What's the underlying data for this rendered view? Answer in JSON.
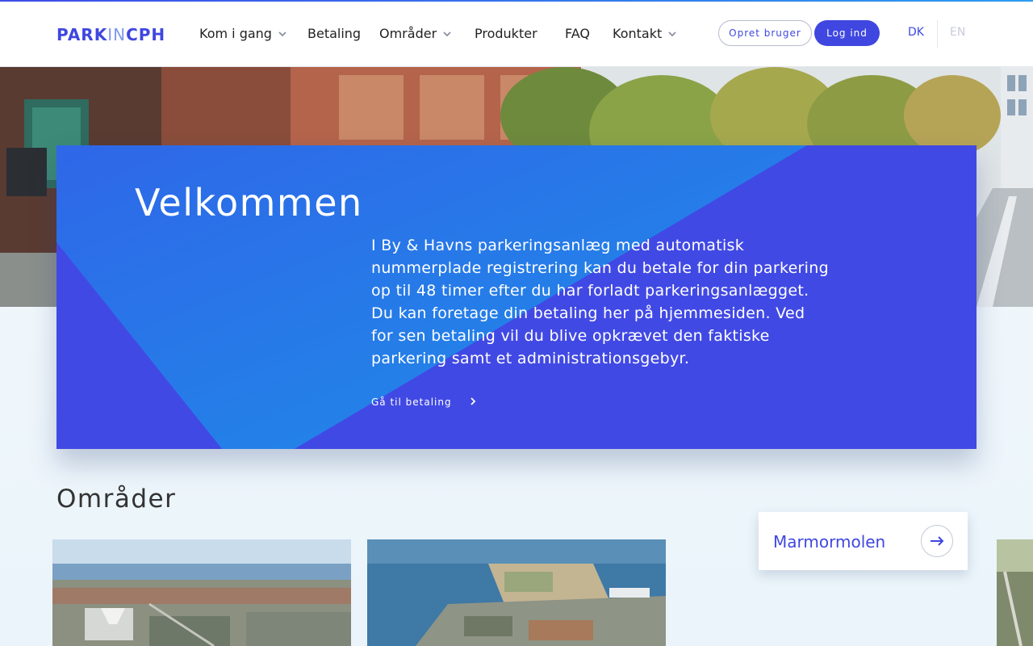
{
  "brand": {
    "logo_part1": "PARK",
    "logo_part2": "IN",
    "logo_part3": "CPH",
    "accent_color": "#3f47e0",
    "secondary_color": "#2d9cf0"
  },
  "nav": {
    "items": [
      {
        "label": "Kom i gang",
        "has_dropdown": true
      },
      {
        "label": "Betaling",
        "has_dropdown": false
      },
      {
        "label": "Områder",
        "has_dropdown": true
      },
      {
        "label": "Produkter",
        "has_dropdown": false
      },
      {
        "label": "FAQ",
        "has_dropdown": false
      },
      {
        "label": "Kontakt",
        "has_dropdown": true
      }
    ]
  },
  "auth": {
    "signup_label": "Opret bruger",
    "login_label": "Log ind"
  },
  "language": {
    "dk": "DK",
    "en": "EN",
    "active": "DK"
  },
  "welcome": {
    "title": "Velkommen",
    "body": "I By & Havns parkeringsanlæg med automatisk nummerplade registrering kan du betale for din parkering op til 48 timer efter du har forladt parkeringsanlægget. Du kan foretage din betaling her på hjemmesiden. Ved for sen betaling vil du blive opkrævet den faktiske parkering samt et administrationsgebyr.",
    "link_label": "Gå til betaling"
  },
  "areas": {
    "title": "Områder",
    "featured_card": "Marmormolen",
    "icons": {
      "card_button": "arrow-right-icon",
      "dropdown": "chevron-down-icon",
      "link": "chevron-right-icon"
    }
  }
}
